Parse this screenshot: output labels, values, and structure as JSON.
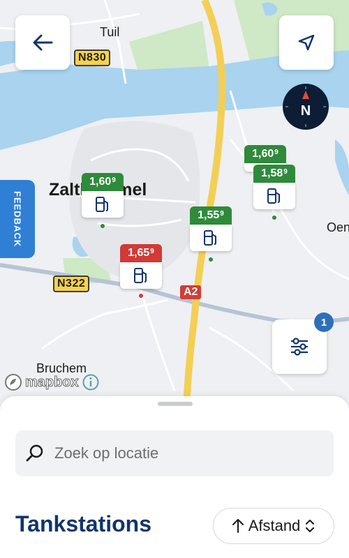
{
  "map": {
    "places": [
      {
        "name": "Tuil"
      },
      {
        "name": "Zaltbommel"
      },
      {
        "name": "Oen"
      },
      {
        "name": "Bruchem"
      }
    ],
    "roads": {
      "n830": "N830",
      "n322": "N322",
      "a2": "A2"
    },
    "attribution": "mapbox",
    "compass_label": "N",
    "feedback_label": "FEEDBACK",
    "filter_badge_count": "1",
    "stations": [
      {
        "price_main": "1,60",
        "price_sup": "9",
        "status": "green"
      },
      {
        "price_main": "1,65",
        "price_sup": "9",
        "status": "red"
      },
      {
        "price_main": "1,55",
        "price_sup": "9",
        "status": "green"
      },
      {
        "price_main": "1,60",
        "price_sup": "9",
        "status": "green"
      },
      {
        "price_main": "1,58",
        "price_sup": "9",
        "status": "green"
      }
    ],
    "icons": [
      "back-arrow-icon",
      "navigation-arrow-icon",
      "compass-icon",
      "filter-sliders-icon",
      "fuel-pump-icon",
      "info-icon",
      "mapbox-logo-icon"
    ]
  },
  "sheet": {
    "search_placeholder": "Zoek op locatie",
    "title": "Tankstations",
    "sort_label": "Afstand"
  },
  "colors": {
    "accent_blue": "#10356d",
    "price_green": "#2f8a3b",
    "price_red": "#d13a36",
    "feedback_blue": "#2f7fd4",
    "water": "#a9d3ef",
    "motorway": "#f4cf55"
  }
}
